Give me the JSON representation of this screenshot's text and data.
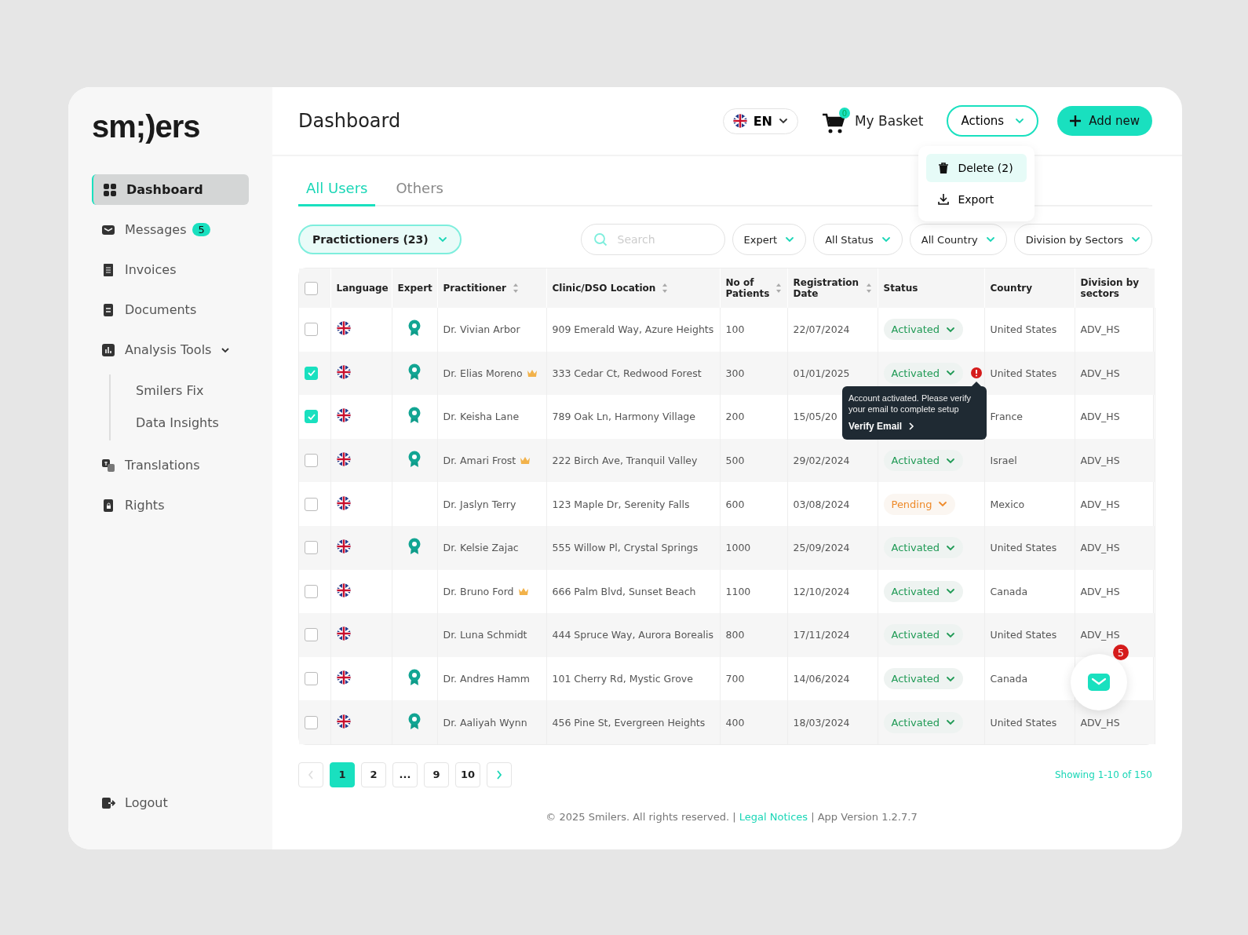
{
  "logo": "sm;)ers",
  "sidebar": {
    "items": [
      {
        "label": "Dashboard",
        "selected": true
      },
      {
        "label": "Messages",
        "selected": false,
        "badge": "5"
      },
      {
        "label": "Invoices",
        "selected": false
      },
      {
        "label": "Documents",
        "selected": false
      },
      {
        "label": "Analysis Tools",
        "selected": false,
        "expanded": true,
        "children": [
          {
            "label": "Smilers Fix",
            "selected": false
          },
          {
            "label": "Data Insights",
            "selected": false
          }
        ]
      },
      {
        "label": "Translations",
        "selected": false
      },
      {
        "label": "Rights",
        "selected": false
      }
    ],
    "logout": "Logout"
  },
  "header": {
    "title": "Dashboard",
    "language": "EN",
    "basket": {
      "label": "My Basket",
      "count": "0"
    },
    "actions": {
      "label": "Actions",
      "expanded": true,
      "menu": [
        {
          "label": "Delete (2)",
          "selected": true
        },
        {
          "label": "Export",
          "selected": false
        }
      ]
    },
    "add_button": "Add new"
  },
  "tabs": [
    {
      "label": "All Users",
      "selected": true
    },
    {
      "label": "Others",
      "selected": false
    }
  ],
  "filters": {
    "group": "Practictioners (23)",
    "search": {
      "placeholder": "Search"
    },
    "dropdowns": [
      "Expert",
      "All Status",
      "All Country",
      "Division by Sectors"
    ]
  },
  "table": {
    "all_checked": false,
    "columns": [
      {
        "label": "Language",
        "sortable": false
      },
      {
        "label": "Expert",
        "sortable": false
      },
      {
        "label": "Practitioner",
        "sortable": true
      },
      {
        "label": "Clinic/DSO Location",
        "sortable": true
      },
      {
        "label": "No of Patients",
        "sortable": true
      },
      {
        "label": "Registration Date",
        "sortable": true
      },
      {
        "label": "Status",
        "sortable": false
      },
      {
        "label": "Country",
        "sortable": false
      },
      {
        "label": "Division by sectors",
        "sortable": false
      }
    ],
    "rows": [
      {
        "checked": false,
        "expert": true,
        "name": "Dr. Vivian Arbor",
        "crown": false,
        "location": "909 Emerald Way, Azure Heights",
        "patients": "100",
        "date": "22/07/2024",
        "status": {
          "label": "Activated",
          "kind": "activated"
        },
        "country": "United States",
        "division": "ADV_HS"
      },
      {
        "checked": true,
        "expert": true,
        "name": "Dr. Elias Moreno",
        "crown": true,
        "location": "333 Cedar Ct, Redwood Forest",
        "patients": "300",
        "date": "01/01/2025",
        "status": {
          "label": "Activated",
          "kind": "activated"
        },
        "alert": {
          "text": "Account activated. Please verify your email to complete setup",
          "link": "Verify Email"
        },
        "country": "United States",
        "division": "ADV_HS"
      },
      {
        "checked": true,
        "expert": true,
        "name": "Dr. Keisha Lane",
        "crown": false,
        "location": "789 Oak Ln, Harmony Village",
        "patients": "200",
        "date": "15/05/20",
        "country": "France",
        "division": "ADV_HS"
      },
      {
        "checked": false,
        "expert": true,
        "name": "Dr. Amari Frost",
        "crown": true,
        "location": "222 Birch Ave, Tranquil Valley",
        "patients": "500",
        "date": "29/02/2024",
        "status": {
          "label": "Activated",
          "kind": "activated"
        },
        "country": "Israel",
        "division": "ADV_HS"
      },
      {
        "checked": false,
        "expert": false,
        "name": "Dr. Jaslyn Terry",
        "crown": false,
        "location": "123 Maple Dr, Serenity Falls",
        "patients": "600",
        "date": "03/08/2024",
        "status": {
          "label": "Pending",
          "kind": "pending"
        },
        "country": "Mexico",
        "division": "ADV_HS"
      },
      {
        "checked": false,
        "expert": true,
        "name": "Dr. Kelsie Zajac",
        "crown": false,
        "location": "555 Willow Pl, Crystal Springs",
        "patients": "1000",
        "date": "25/09/2024",
        "status": {
          "label": "Activated",
          "kind": "activated"
        },
        "country": "United States",
        "division": "ADV_HS"
      },
      {
        "checked": false,
        "expert": false,
        "name": "Dr. Bruno Ford",
        "crown": true,
        "location": "666 Palm Blvd, Sunset Beach",
        "patients": "1100",
        "date": "12/10/2024",
        "status": {
          "label": "Activated",
          "kind": "activated"
        },
        "country": "Canada",
        "division": "ADV_HS"
      },
      {
        "checked": false,
        "expert": false,
        "name": "Dr. Luna Schmidt",
        "crown": false,
        "location": "444 Spruce Way, Aurora Borealis",
        "patients": "800",
        "date": "17/11/2024",
        "status": {
          "label": "Activated",
          "kind": "activated"
        },
        "country": "United States",
        "division": "ADV_HS"
      },
      {
        "checked": false,
        "expert": true,
        "name": "Dr. Andres Hamm",
        "crown": false,
        "location": "101 Cherry Rd, Mystic Grove",
        "patients": "700",
        "date": "14/06/2024",
        "status": {
          "label": "Activated",
          "kind": "activated"
        },
        "country": "Canada"
      },
      {
        "checked": false,
        "expert": true,
        "name": "Dr. Aaliyah Wynn",
        "crown": false,
        "location": "456 Pine St, Evergreen Heights",
        "patients": "400",
        "date": "18/03/2024",
        "status": {
          "label": "Activated",
          "kind": "activated"
        },
        "country": "United States",
        "division": "ADV_HS"
      }
    ]
  },
  "pagination": {
    "prev_disabled": true,
    "next_disabled": false,
    "pages": [
      {
        "label": "1",
        "selected": true
      },
      {
        "label": "2",
        "selected": false
      },
      {
        "label": "...",
        "selected": false
      },
      {
        "label": "9",
        "selected": false
      },
      {
        "label": "10",
        "selected": false
      }
    ],
    "summary": "Showing 1-10 of 150"
  },
  "footer": {
    "text": "© 2025 Smilers. All rights reserved. |",
    "link": "Legal Notices",
    "version": "| App Version 1.2.7.7"
  },
  "chat": {
    "badge": "5"
  }
}
